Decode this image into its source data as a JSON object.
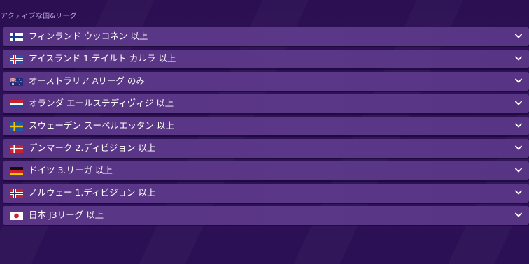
{
  "section": {
    "title": "アクティブな国&リーグ"
  },
  "leagues": [
    {
      "label": "フィンランド ウッコネン 以上",
      "flag": "finland-flag-icon"
    },
    {
      "label": "アイスランド 1.テイルト カルラ 以上",
      "flag": "iceland-flag-icon"
    },
    {
      "label": "オーストラリア Aリーグ のみ",
      "flag": "australia-flag-icon"
    },
    {
      "label": "オランダ エールステディヴィジ 以上",
      "flag": "netherlands-flag-icon"
    },
    {
      "label": "スウェーデン スーペルエッタン 以上",
      "flag": "sweden-flag-icon"
    },
    {
      "label": "デンマーク 2.ディビジョン 以上",
      "flag": "denmark-flag-icon"
    },
    {
      "label": "ドイツ 3.リーガ 以上",
      "flag": "germany-flag-icon"
    },
    {
      "label": "ノルウェー 1.ディビジョン 以上",
      "flag": "norway-flag-icon"
    },
    {
      "label": "日本 J3リーグ 以上",
      "flag": "japan-flag-icon"
    }
  ],
  "icons": {
    "expand": "chevron-down-icon"
  },
  "colors": {
    "background": "#2b0f52",
    "row": "#5a3585",
    "section_title": "#b9a6d6",
    "text": "#ffffff"
  }
}
